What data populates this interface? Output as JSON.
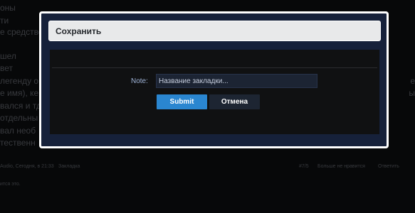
{
  "modal": {
    "title": "Сохранить",
    "note_label": "Note:",
    "note_placeholder": "Название закладки...",
    "submit_label": "Submit",
    "cancel_label": "Отмена"
  },
  "background": {
    "left_lines": [
      "оны",
      "ти",
      "е средстве",
      "",
      "шел",
      "вет",
      "легенду о",
      "е имя), ке",
      "вался и тд",
      "отдельны",
      "вал необ",
      "тественн"
    ],
    "right_lines": [
      "е",
      "ы"
    ],
    "footer": {
      "author_date": "Audio, Сегодня, в 21:33",
      "bookmark": "Закладка",
      "post_number": "#7/5",
      "dislike": "Больше не нравится",
      "reply": "Ответить",
      "liked": "ится это."
    }
  }
}
